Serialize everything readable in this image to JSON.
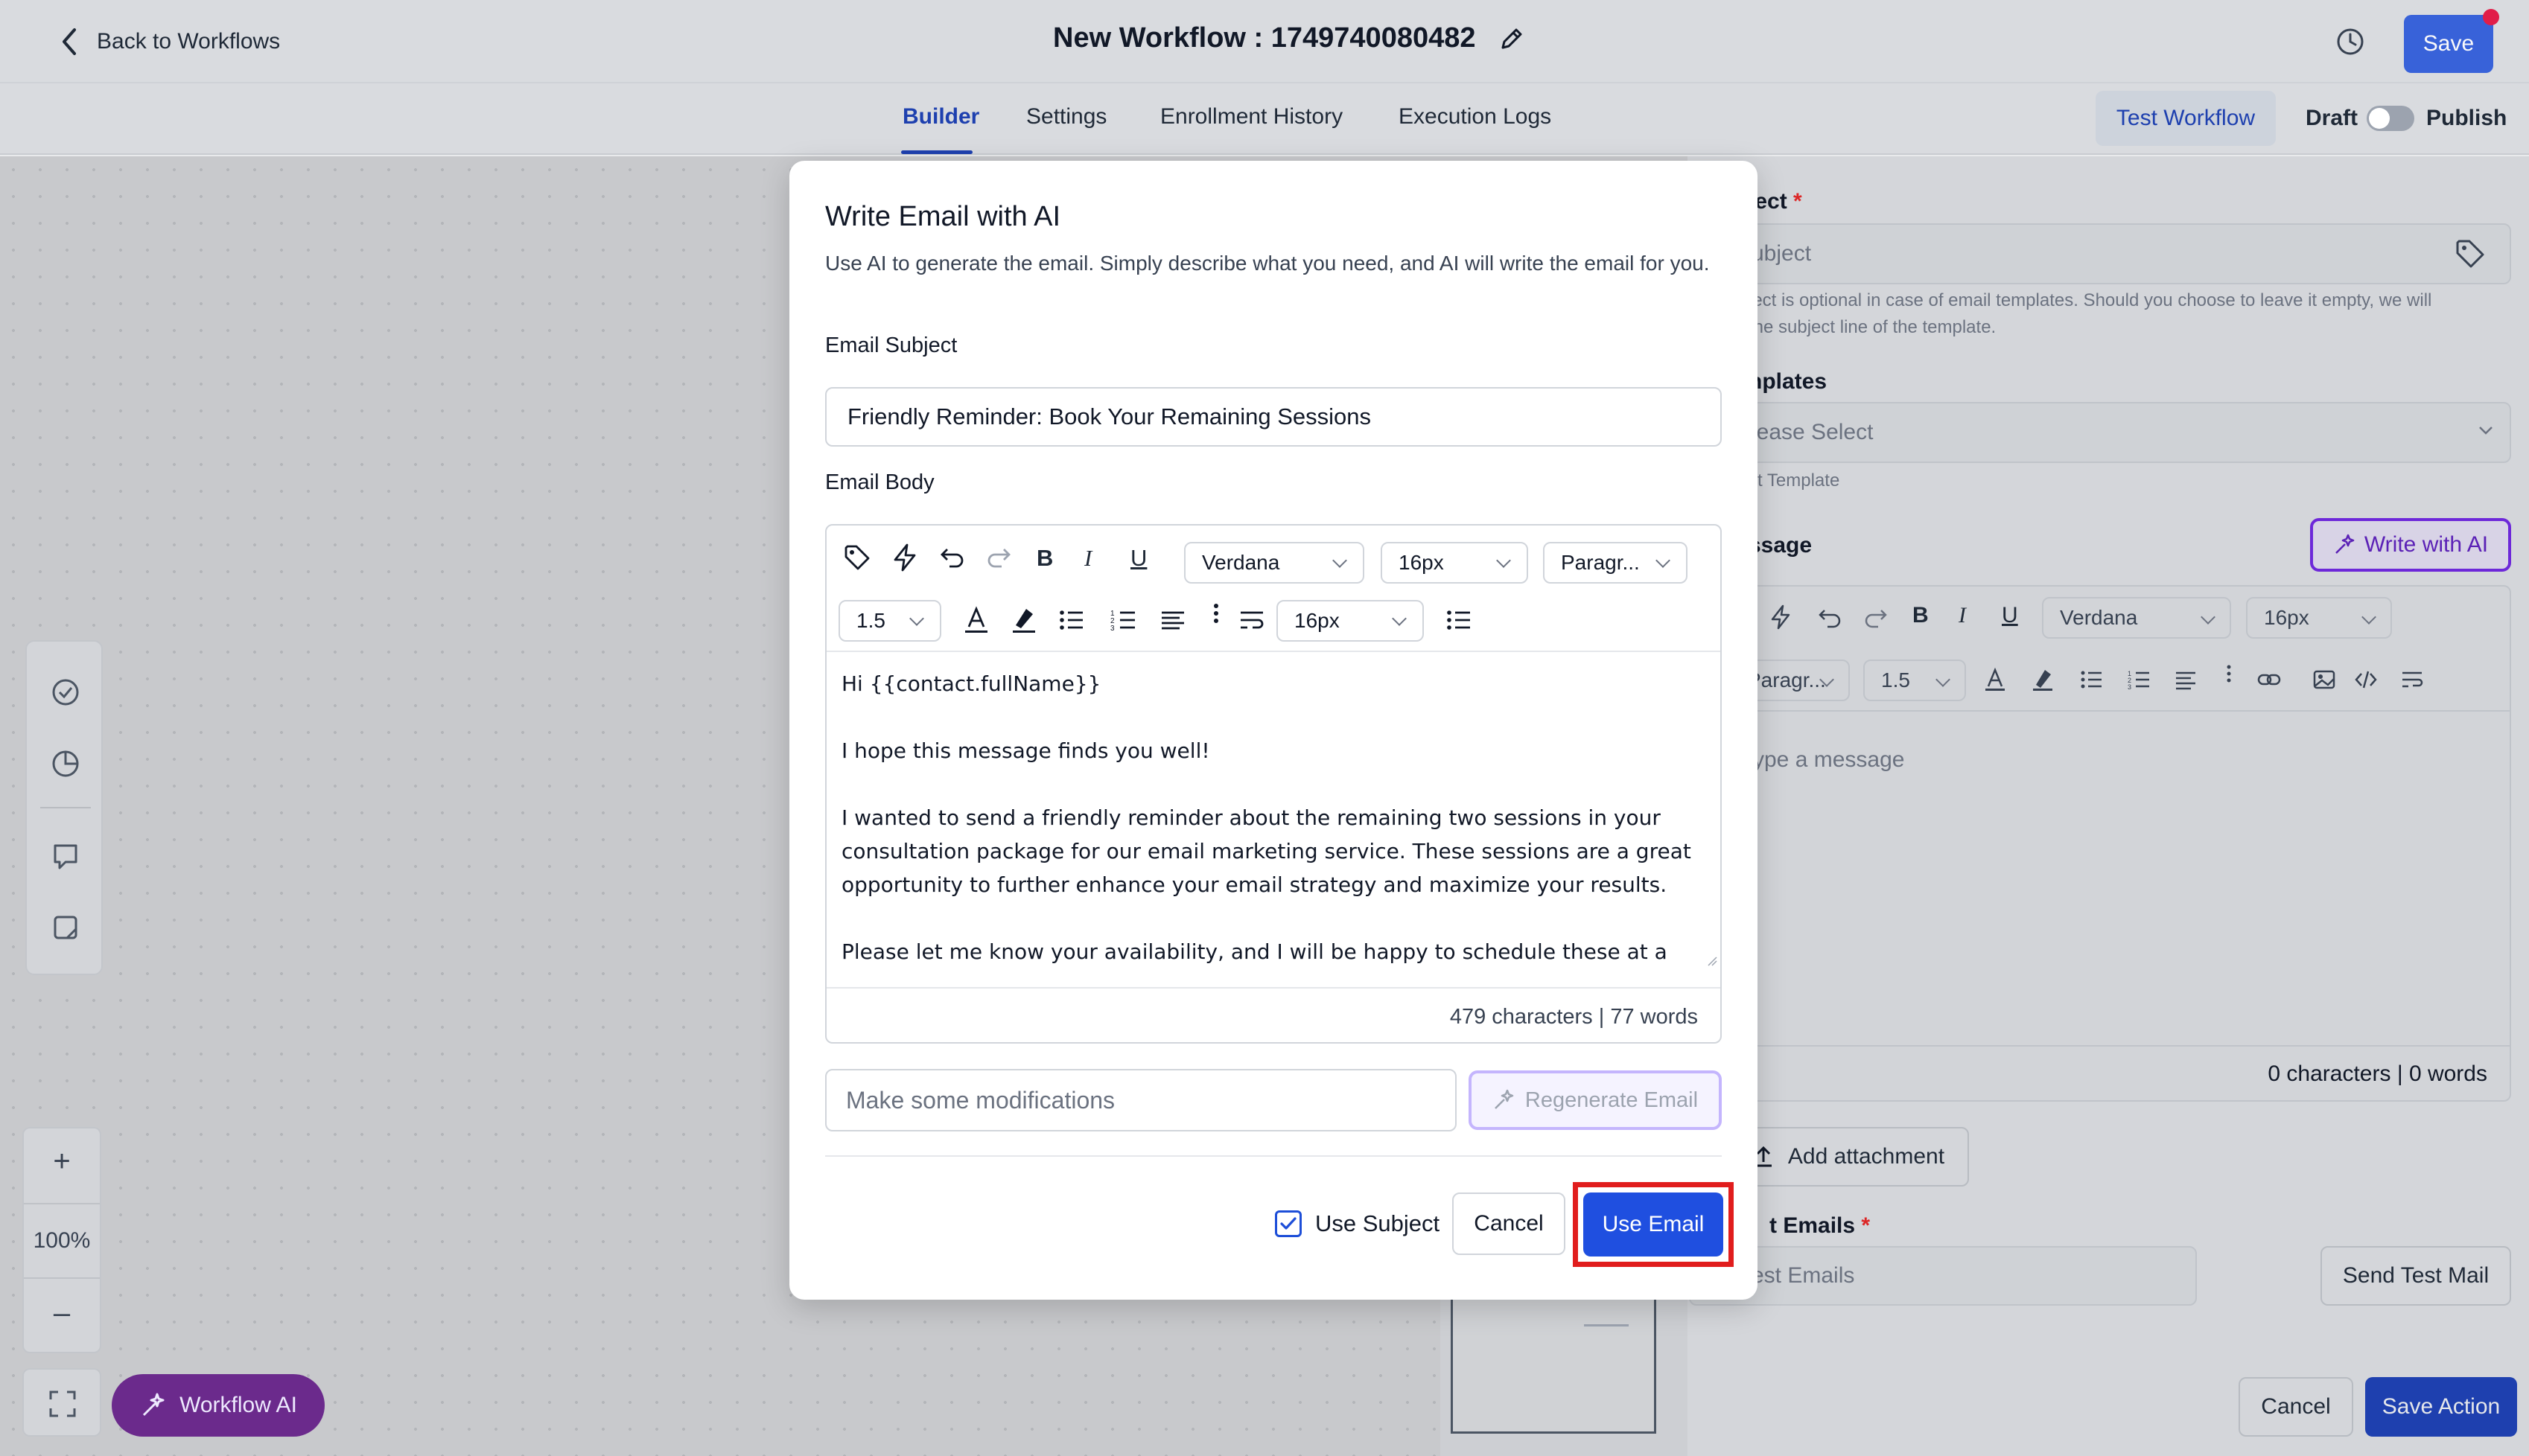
{
  "header": {
    "back_label": "Back to Workflows",
    "title": "New Workflow : 1749740080482",
    "save_label": "Save"
  },
  "tabs": [
    {
      "label": "Builder",
      "active": true
    },
    {
      "label": "Settings"
    },
    {
      "label": "Enrollment History"
    },
    {
      "label": "Execution Logs"
    }
  ],
  "toolbar": {
    "test_workflow": "Test Workflow",
    "draft": "Draft",
    "publish": "Publish"
  },
  "canvas": {
    "zoom": "100%",
    "zoom_in": "+",
    "zoom_out": "–",
    "workflow_ai": "Workflow AI"
  },
  "right_panel": {
    "subject_label": "ject",
    "subject_required": "*",
    "subject_placeholder": "ubject",
    "subject_help": "ject is optional in case of email templates. Should you choose to leave it empty, we will\n the subject line of the template.",
    "templates_label": "nplates",
    "templates_placeholder": "lease Select",
    "templates_help": "ct Template",
    "message_label": "ssage",
    "write_ai": "Write with AI",
    "font": "Verdana",
    "size": "16px",
    "paragraph": "Paragr...",
    "line_height": "1.5",
    "message_placeholder": "ype a message",
    "count": "0 characters | 0 words",
    "add_attachment": "Add attachment",
    "test_emails_label": "t Emails",
    "test_emails_required": "*",
    "test_emails_placeholder": "est Emails",
    "send_test": "Send Test Mail",
    "cancel": "Cancel",
    "save_action": "Save Action"
  },
  "modal": {
    "title": "Write Email with AI",
    "description": "Use AI to generate the email. Simply describe what you need, and AI will write the email for you.",
    "subject_label": "Email Subject",
    "subject_value": "Friendly Reminder: Book Your Remaining Sessions",
    "body_label": "Email Body",
    "toolbar": {
      "font": "Verdana",
      "size": "16px",
      "paragraph": "Paragr...",
      "line_height": "1.5",
      "size2": "16px"
    },
    "body": {
      "greeting": "Hi {{contact.fullName}}",
      "line1": "I hope this message finds you well!",
      "line2": "I wanted to send a friendly reminder about the remaining two sessions in your consultation package for our email marketing service. These sessions are a great opportunity to further enhance your email strategy and maximize your results.",
      "line3": "Please let me know your availability, and I will be happy to schedule these at a"
    },
    "count": "479 characters | 77 words",
    "modify_placeholder": "Make some modifications",
    "regenerate": "Regenerate Email",
    "use_subject": "Use Subject",
    "use_subject_checked": true,
    "cancel": "Cancel",
    "use_email": "Use Email"
  },
  "colors": {
    "primary": "#1f4fe0",
    "accent_purple": "#6d28d9",
    "highlight_red": "#e11d1d"
  }
}
